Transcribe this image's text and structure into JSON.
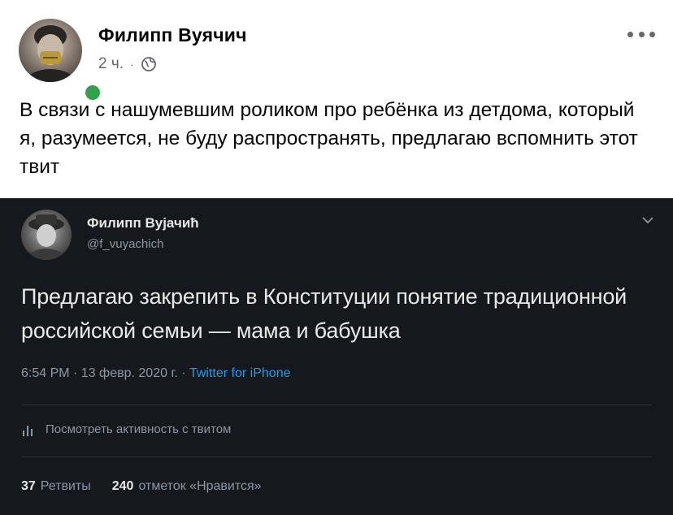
{
  "post": {
    "author": "Филипп Вуячич",
    "time": "2 ч.",
    "separator": "·",
    "icons": {
      "privacy": "globe-icon",
      "more": "more-options-icon",
      "status": "online-indicator"
    },
    "text": "В связи с нашумевшим роликом про ребёнка из детдома, который я, разумеется, не буду распространять, предлагаю вспомнить этот твит"
  },
  "tweet": {
    "name": "Филипп Вујачић",
    "handle": "@f_vuyachich",
    "text": "Предлагаю закрепить в Конституции понятие традиционной российской семьи — мама и бабушка",
    "time": "6:54 PM · 13 февр. 2020 г. · ",
    "source": "Twitter for iPhone",
    "activity_label": "Посмотреть активность с твитом",
    "retweets_count": "37",
    "retweets_label": "Ретвиты",
    "likes_count": "240",
    "likes_label": "отметок «Нравится»",
    "icons": {
      "menu": "chevron-down-icon",
      "activity": "bar-chart-icon"
    }
  },
  "colors": {
    "fb_text": "#050505",
    "fb_meta": "#65676b",
    "online": "#31a24c",
    "tweet_bg": "#15181c",
    "tweet_link": "#1d9bf0"
  }
}
